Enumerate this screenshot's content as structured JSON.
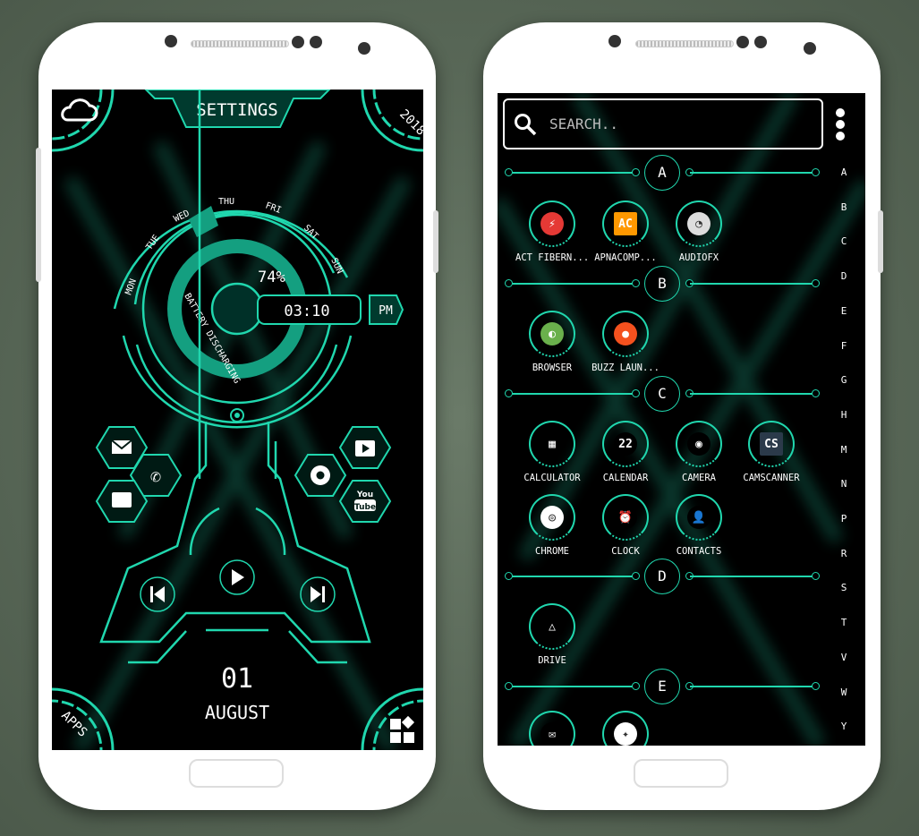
{
  "colors": {
    "accent": "#20d7ae",
    "screen_bg": "#000000",
    "phone_body": "#ffffff"
  },
  "left_phone": {
    "settings_label": "SETTINGS",
    "year": "2018",
    "weather_icon": "cloud-icon",
    "weekdays": [
      "MON",
      "TUE",
      "WED",
      "THU",
      "FRI",
      "SAT",
      "SUN"
    ],
    "active_weekday": "WED",
    "battery_percent": "74%",
    "battery_level": 74,
    "battery_status": "BATTERY DISCHARGING",
    "time": "03:10",
    "ampm": "PM",
    "shortcuts_left": [
      "email-icon",
      "phone-icon",
      "message-icon"
    ],
    "shortcuts_right": [
      "play-store-icon",
      "chrome-icon",
      "youtube-icon"
    ],
    "youtube_text": [
      "You",
      "Tube"
    ],
    "media": [
      "previous-icon",
      "play-icon",
      "next-icon"
    ],
    "day": "01",
    "month": "AUGUST",
    "apps_label": "APPS",
    "widgets_icon": "widgets-icon"
  },
  "right_phone": {
    "search_placeholder": "SEARCH..",
    "menu_icon": "more-vert-icon",
    "sections": [
      {
        "letter": "A",
        "apps": [
          {
            "name": "ACT FIBERN...",
            "icon": "act-fibernet-icon",
            "color": "#e53935",
            "glyph": "⚡"
          },
          {
            "name": "APNACOMP...",
            "icon": "apnacomp-icon",
            "color": "#ff9800",
            "glyph": "AC"
          },
          {
            "name": "AUDIOFX",
            "icon": "audiofx-icon",
            "color": "#dddddd",
            "glyph": "◔"
          }
        ]
      },
      {
        "letter": "B",
        "apps": [
          {
            "name": "BROWSER",
            "icon": "browser-icon",
            "color": "#6ab04c",
            "glyph": "◐"
          },
          {
            "name": "BUZZ LAUN...",
            "icon": "buzz-launcher-icon",
            "color": "#f4511e",
            "glyph": "●"
          }
        ]
      },
      {
        "letter": "C",
        "apps": [
          {
            "name": "CALCULATOR",
            "icon": "calculator-icon",
            "color": "#000000",
            "glyph": "▦"
          },
          {
            "name": "CALENDAR",
            "icon": "calendar-icon",
            "color": "#000000",
            "glyph": "22"
          },
          {
            "name": "CAMERA",
            "icon": "camera-icon",
            "color": "#000000",
            "glyph": "◉"
          },
          {
            "name": "CAMSCANNER",
            "icon": "camscanner-icon",
            "color": "#2b3a4a",
            "glyph": "CS"
          },
          {
            "name": "CHROME",
            "icon": "chrome-icon",
            "color": "#ffffff",
            "glyph": "◎"
          },
          {
            "name": "CLOCK",
            "icon": "clock-icon",
            "color": "#000000",
            "glyph": "⏰"
          },
          {
            "name": "CONTACTS",
            "icon": "contacts-icon",
            "color": "#000000",
            "glyph": "👤"
          }
        ]
      },
      {
        "letter": "D",
        "apps": [
          {
            "name": "DRIVE",
            "icon": "drive-icon",
            "color": "#000000",
            "glyph": "△"
          }
        ]
      },
      {
        "letter": "E",
        "apps": [
          {
            "name": "",
            "icon": "email-icon",
            "color": "#000000",
            "glyph": "✉"
          },
          {
            "name": "",
            "icon": "e-app-icon",
            "color": "#ffffff",
            "glyph": "✦"
          }
        ]
      }
    ],
    "index_letters": [
      "A",
      "B",
      "C",
      "D",
      "E",
      "F",
      "G",
      "H",
      "M",
      "N",
      "P",
      "R",
      "S",
      "T",
      "V",
      "W",
      "Y"
    ]
  }
}
